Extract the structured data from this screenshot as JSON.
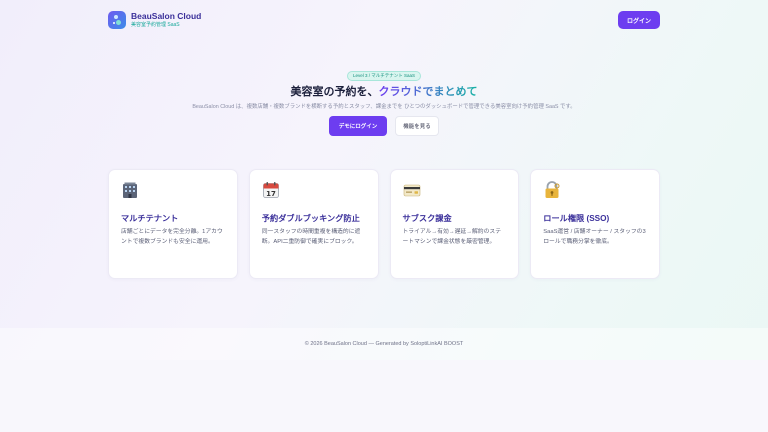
{
  "header": {
    "brand_name": "BeauSalon Cloud",
    "brand_sub": "美容室予約管理 SaaS",
    "login_label": "ログイン"
  },
  "hero": {
    "badge": "Level 3 / マルチテナント SaaS",
    "title_plain": "美容室の予約を、",
    "title_accent": "クラウドでまとめて",
    "description": "BeauSalon Cloud は、複数店舗・複数ブランドを横断する予約とスタッフ、課金までを ひとつのダッシュボードで管理できる美容室向け予約管理 SaaS です。"
  },
  "cta": {
    "primary_label": "デモにログイン",
    "secondary_label": "機能を見る"
  },
  "features": [
    {
      "icon": "building-icon",
      "title": "マルチテナント",
      "description": "店舗ごとにデータを完全分離。1アカウントで複数ブランドも安全に運用。"
    },
    {
      "icon": "calendar-icon",
      "title": "予約ダブルブッキング防止",
      "description": "同一スタッフの時間重複を構造的に遮断。API二重防御で確実にブロック。"
    },
    {
      "icon": "credit-card-icon",
      "title": "サブスク課金",
      "description": "トライアル→有効→遅延→解約のステートマシンで課金状態を厳密管理。"
    },
    {
      "icon": "lock-key-icon",
      "title": "ロール権限 (SSO)",
      "description": "SaaS運営 / 店舗オーナー / スタッフの3ロールで職務分掌を徹底。"
    }
  ],
  "footer": {
    "text": "© 2026 BeauSalon Cloud — Generated by SoloptiLinkAI BOOST"
  },
  "colors": {
    "accent": "#6d3df0",
    "brand_text": "#3a2f9a",
    "teal": "#17a89a"
  }
}
